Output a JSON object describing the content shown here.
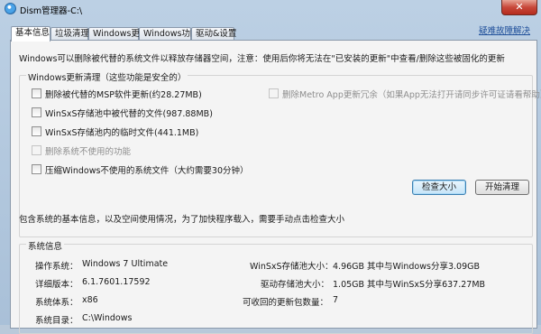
{
  "window": {
    "title": "Dism管理器-C:\\",
    "close_glyph": "✕",
    "menu_link": "疑难故障解决"
  },
  "tabs": [
    {
      "label": "基本信息",
      "active": true
    },
    {
      "label": "垃圾清理",
      "active": false
    },
    {
      "label": "Windows更新",
      "active": false
    },
    {
      "label": "Windows功能",
      "active": false
    },
    {
      "label": "驱动&设置",
      "active": false
    }
  ],
  "intro": "Windows可以删除被代替的系统文件以释放存储器空间，注意：使用后你将无法在\"已安装的更新\"中查看/删除这些被固化的更新",
  "cleanup": {
    "group_title": "Windows更新清理（这些功能是安全的）",
    "items": [
      {
        "label": "删除被代替的MSP软件更新(约28.27MB)",
        "enabled": true
      },
      {
        "label": "WinSxS存储池中被代替的文件(987.88MB)",
        "enabled": true
      },
      {
        "label": "WinSxS存储池内的临时文件(441.1MB)",
        "enabled": true
      },
      {
        "label": "删除系统不使用的功能",
        "enabled": false
      },
      {
        "label": "压缩Windows不使用的系统文件（大约需要30分钟）",
        "enabled": true
      }
    ],
    "metro_item": {
      "label": "删除Metro App更新冗余（如果App无法打开请同步许可证请看帮助）",
      "enabled": false
    },
    "check_button": "检查大小",
    "start_button": "开始清理"
  },
  "note": "包含系统的基本信息，以及空间使用情况，为了加快程序载入，需要手动点击检查大小",
  "sysinfo": {
    "group_title": "系统信息",
    "rows": [
      {
        "label": "操作系统：",
        "value": "Windows 7 Ultimate"
      },
      {
        "label": "详细版本：",
        "value": "6.1.7601.17592"
      },
      {
        "label": "系统体系：",
        "value": "x86"
      },
      {
        "label": "系统目录：",
        "value": "C:\\Windows"
      }
    ],
    "right_rows": [
      {
        "label": "WinSxS存储池大小：",
        "value": "4.96GB  其中与Windows分享3.09GB"
      },
      {
        "label": "驱动存储池大小：",
        "value": "1.05GB  其中与WinSxS分享637.27MB"
      },
      {
        "label": "可收回的更新包数量：",
        "value": "7"
      }
    ]
  }
}
